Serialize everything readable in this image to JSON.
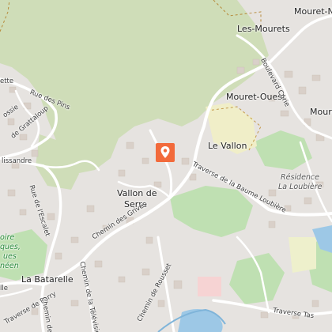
{
  "map": {
    "colors": {
      "land": "#e6e3e0",
      "forest": "#cfddb8",
      "park": "#bfe0b2",
      "water": "#9dc8e6",
      "road": "#ffffff",
      "building": "#d9d0c9",
      "marker": "#f26a3b"
    },
    "marker": {
      "icon": "map-pin-icon"
    },
    "place_labels": {
      "les_mourets": "Les-Mourets",
      "mouret_n": "Mouret-N",
      "mouret_ouest": "Mouret-Ouest",
      "mouret_right": "Moure",
      "le_vallon": "Le Vallon",
      "vallon_de_serre_1": "Vallon de",
      "vallon_de_serre_2": "Serre",
      "la_batarelle": "La Batarelle",
      "residence_1": "Résidence",
      "residence_2": "La Loubière"
    },
    "street_labels": {
      "rue_des_pins": "Rue des Pins",
      "ette": "ette",
      "ossie": "ossie",
      "grattaloup": "de Grattaloup",
      "lissandre": "lissandre",
      "rue_escalet": "Rue de l'Escalet",
      "chemin_des_grives": "Chemin des Grives",
      "traverse_baume": "Traverse de la Baume Loubière",
      "boulevard_curie": "Boulevard Curie",
      "chemin_television": "Chemin de la Télévision",
      "chemin_rousset": "Chemin de Rousset",
      "traverse_parry": "Traverse de Parry",
      "chemin_de": "Chemin de",
      "traverse_tas": "Traverse Tas",
      "lle": "lle"
    },
    "green_labels": {
      "oire": "oire",
      "ques": "ques,",
      "ues": "ues",
      "neen": "néen"
    }
  }
}
